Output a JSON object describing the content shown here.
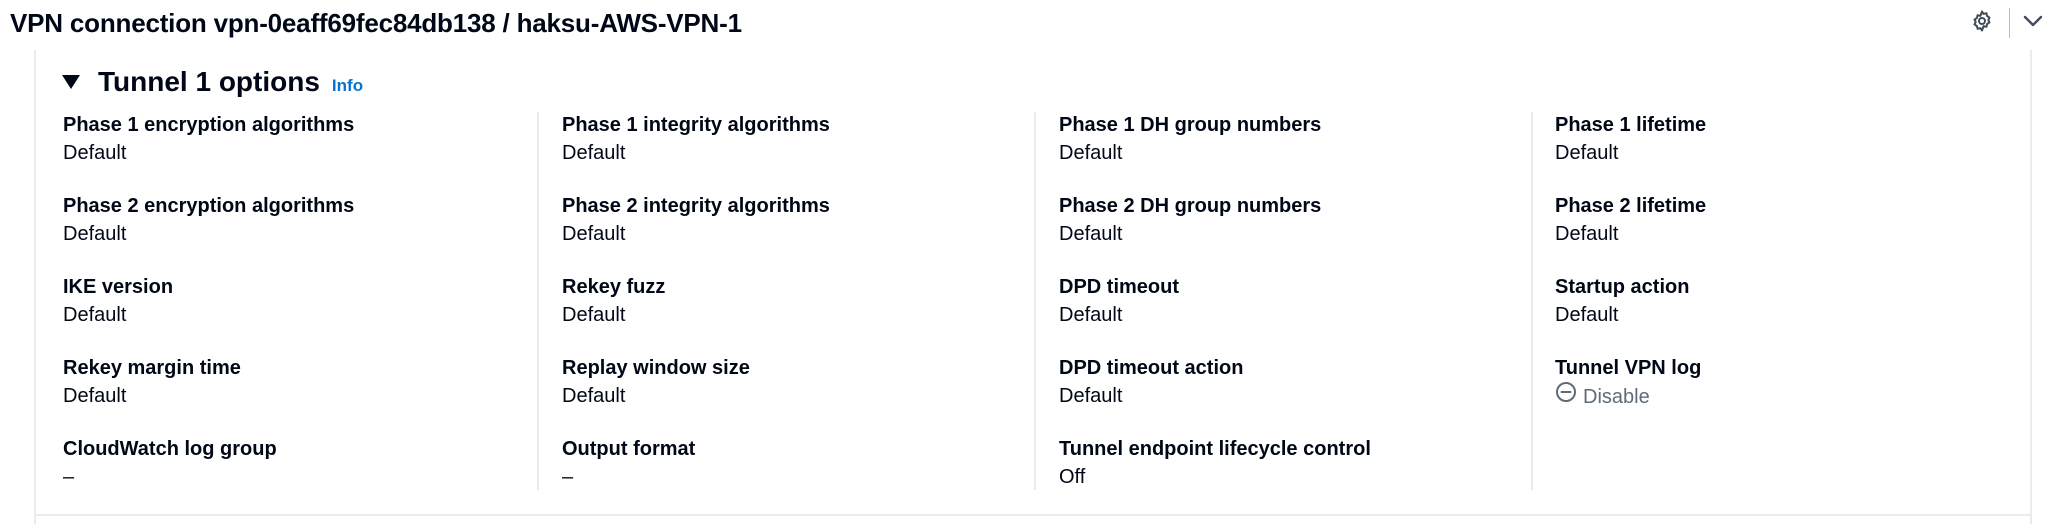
{
  "header": {
    "title": "VPN connection vpn-0eaff69fec84db138 / haksu-AWS-VPN-1",
    "settings_icon": "gear-icon",
    "collapse_icon": "chevron-down-icon"
  },
  "section": {
    "title": "Tunnel 1 options",
    "info_label": "Info",
    "caret_icon": "caret-down-icon"
  },
  "columns": [
    [
      {
        "label": "Phase 1 encryption algorithms",
        "value": "Default"
      },
      {
        "label": "Phase 2 encryption algorithms",
        "value": "Default"
      },
      {
        "label": "IKE version",
        "value": "Default"
      },
      {
        "label": "Rekey margin time",
        "value": "Default"
      },
      {
        "label": "CloudWatch log group",
        "value": "–"
      }
    ],
    [
      {
        "label": "Phase 1 integrity algorithms",
        "value": "Default"
      },
      {
        "label": "Phase 2 integrity algorithms",
        "value": "Default"
      },
      {
        "label": "Rekey fuzz",
        "value": "Default"
      },
      {
        "label": "Replay window size",
        "value": "Default"
      },
      {
        "label": "Output format",
        "value": "–"
      }
    ],
    [
      {
        "label": "Phase 1 DH group numbers",
        "value": "Default"
      },
      {
        "label": "Phase 2 DH group numbers",
        "value": "Default"
      },
      {
        "label": "DPD timeout",
        "value": "Default"
      },
      {
        "label": "DPD timeout action",
        "value": "Default"
      },
      {
        "label": "Tunnel endpoint lifecycle control",
        "value": "Off"
      }
    ],
    [
      {
        "label": "Phase 1 lifetime",
        "value": "Default"
      },
      {
        "label": "Phase 2 lifetime",
        "value": "Default"
      },
      {
        "label": "Startup action",
        "value": "Default"
      },
      {
        "label": "Tunnel VPN log",
        "value": "Disable",
        "status_icon": "disabled-circle-icon"
      }
    ]
  ],
  "colors": {
    "link": "#0972d3",
    "text": "#000716",
    "muted": "#5f6b7a",
    "divider": "#e9ebed"
  }
}
